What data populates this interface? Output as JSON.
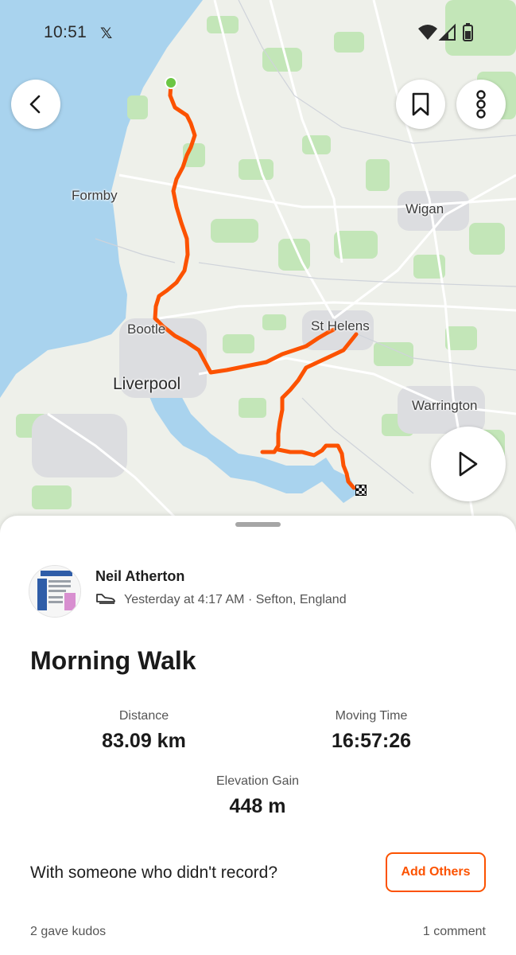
{
  "status_bar": {
    "time": "10:51",
    "notification_icon": "x-logo-icon",
    "wifi_icon": "wifi-icon",
    "signal_icon": "cell-signal-icon",
    "battery_icon": "battery-icon"
  },
  "map": {
    "labels": {
      "formby": "Formby",
      "wigan": "Wigan",
      "bootle": "Bootle",
      "st_helens": "St Helens",
      "liverpool": "Liverpool",
      "warrington": "Warrington"
    },
    "route_color": "#fc5200",
    "start_marker_color": "#6cc644",
    "finish_marker": "checkered-flag-icon",
    "back_icon": "chevron-left-icon",
    "bookmark_icon": "bookmark-icon",
    "more_icon": "more-vertical-icon",
    "play_icon": "play-icon"
  },
  "activity": {
    "athlete_name": "Neil Atherton",
    "sport_icon": "shoe-icon",
    "meta": "Yesterday at 4:17 AM · Sefton, England",
    "title": "Morning Walk",
    "stats": {
      "distance_label": "Distance",
      "distance_value": "83.09 km",
      "moving_time_label": "Moving Time",
      "moving_time_value": "16:57:26",
      "elevation_label": "Elevation Gain",
      "elevation_value": "448 m"
    },
    "with_someone_text": "With someone who didn't record?",
    "add_others_label": "Add Others",
    "kudos_text": "2 gave kudos",
    "comments_text": "1 comment"
  },
  "colors": {
    "accent": "#fc5200",
    "water": "#a9d3ee",
    "land": "#eef0ea",
    "green_area": "#bfe3b4"
  }
}
